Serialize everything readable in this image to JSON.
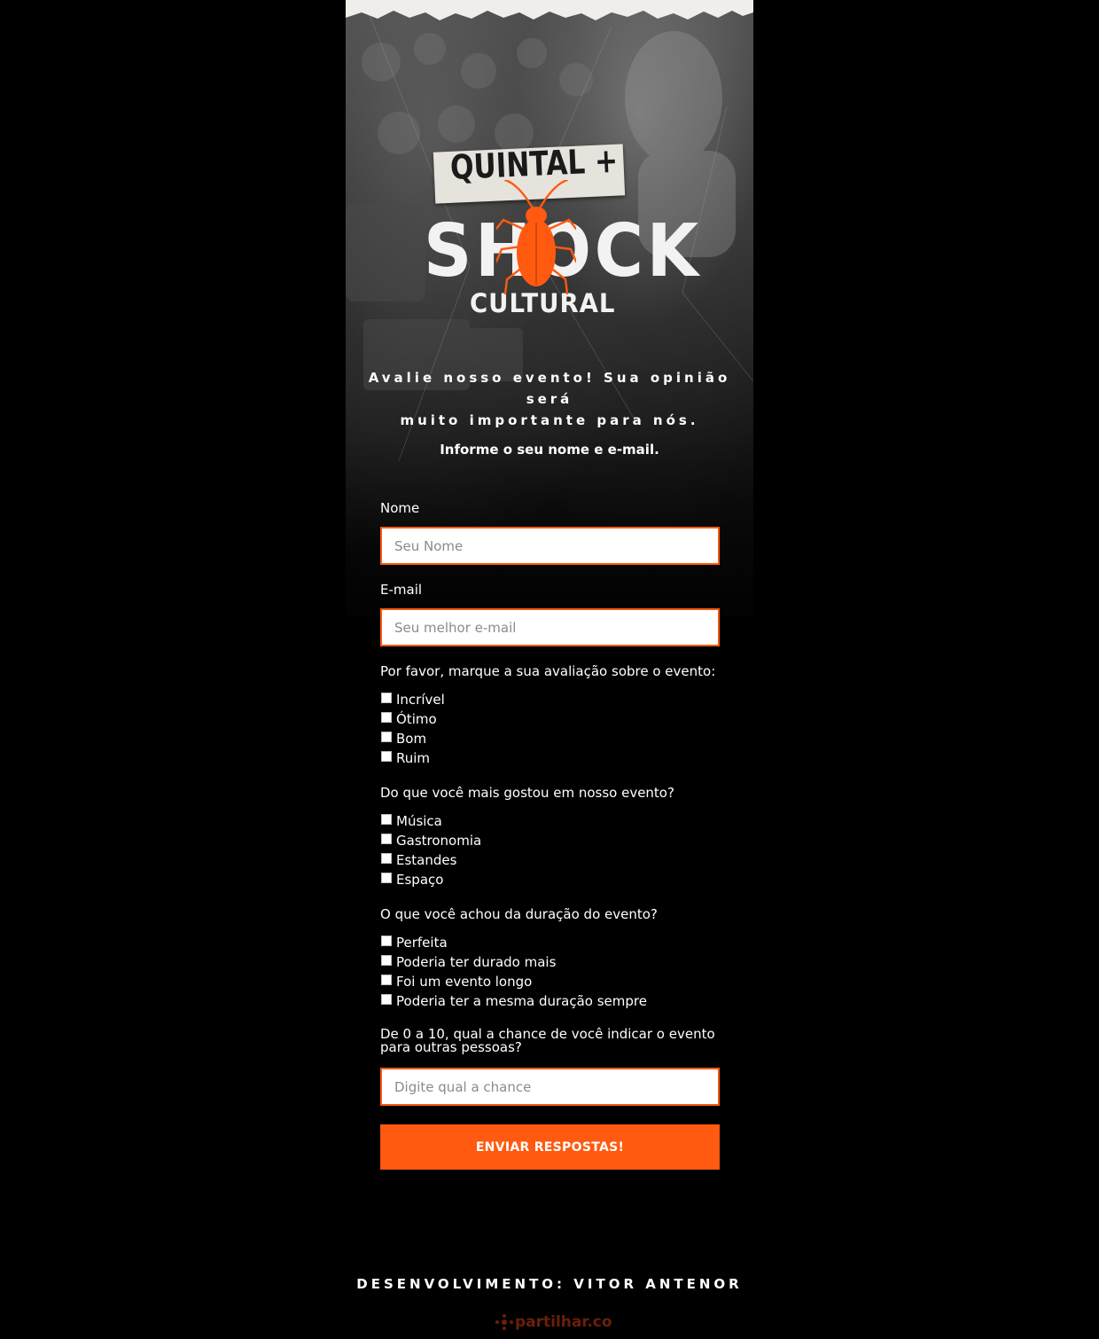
{
  "hero": {
    "logo_line1": "QUINTAL +",
    "logo_line2": "SHOCK",
    "logo_line3": "CULTURAL",
    "headline_line1": "Avalie nosso evento! Sua opinião será",
    "headline_line2": "muito importante para nós.",
    "subheadline": "Informe o seu nome e e-mail."
  },
  "form": {
    "name": {
      "label": "Nome",
      "placeholder": "Seu Nome"
    },
    "email": {
      "label": "E-mail",
      "placeholder": "Seu melhor e-mail"
    },
    "rating": {
      "question": "Por favor, marque a sua avaliação sobre o evento:",
      "options": [
        "Incrível",
        "Ótimo",
        "Bom",
        "Ruim"
      ]
    },
    "liked": {
      "question": "Do que você mais gostou em nosso evento?",
      "options": [
        "Música",
        "Gastronomia",
        "Estandes",
        "Espaço"
      ]
    },
    "duration": {
      "question": "O que você achou da duração do evento?",
      "options": [
        "Perfeita",
        "Poderia ter durado mais",
        "Foi um evento longo",
        "Poderia ter a mesma duração sempre"
      ]
    },
    "nps": {
      "question_line1": "De 0 a 10, qual a chance de você indicar o evento",
      "question_line2": "para outras pessoas?",
      "placeholder": "Digite qual a chance"
    },
    "submit_label": "ENVIAR RESPOSTAS!"
  },
  "footer": {
    "credit": "DESENVOLVIMENTO: VITOR ANTENOR",
    "brand": "partilhar.co"
  },
  "colors": {
    "accent": "#ff5a0f",
    "background": "#000000",
    "text": "#ffffff"
  },
  "icons": {
    "logo_mascot": "orange-cockroach-icon",
    "footer_brand": "partilhar-logo-icon"
  }
}
